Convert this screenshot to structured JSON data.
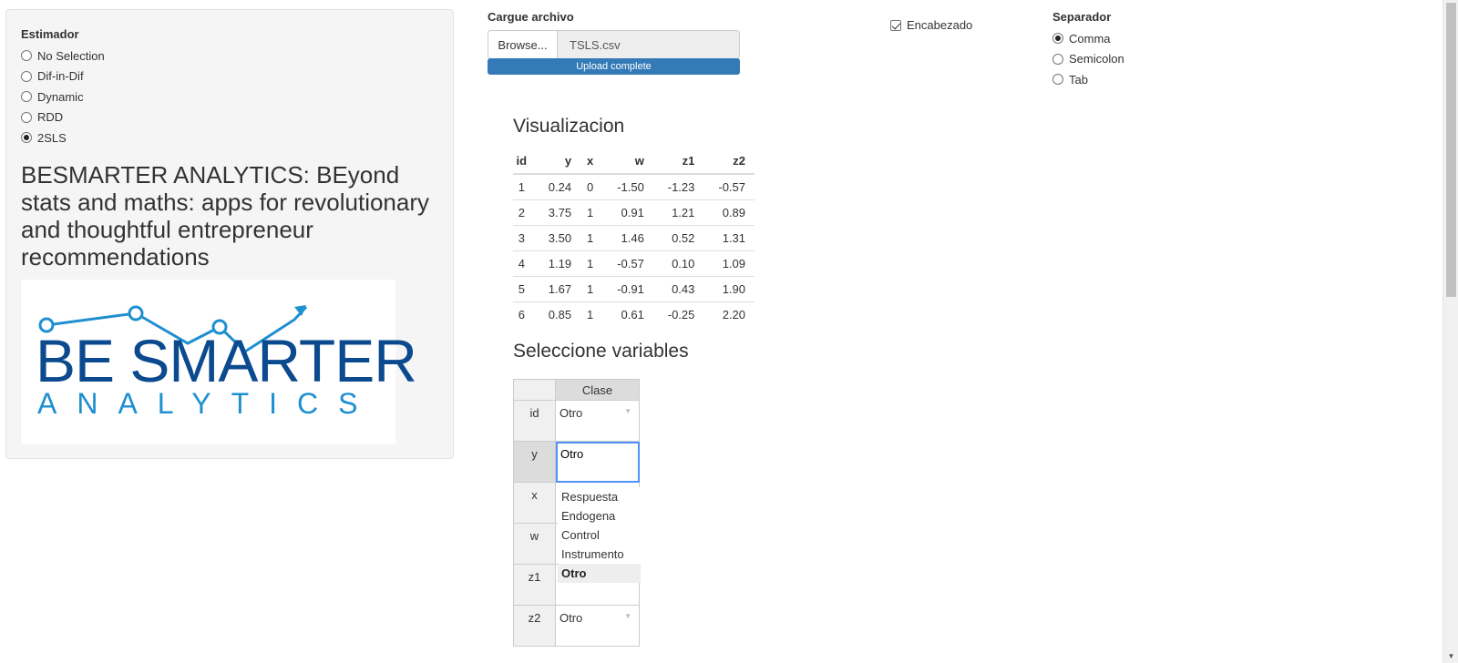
{
  "sidebar": {
    "estimator_label": "Estimador",
    "options": [
      {
        "label": "No Selection",
        "checked": false
      },
      {
        "label": "Dif-in-Dif",
        "checked": false
      },
      {
        "label": "Dynamic",
        "checked": false
      },
      {
        "label": "RDD",
        "checked": false
      },
      {
        "label": "2SLS",
        "checked": true
      }
    ],
    "brand_title": "BESMARTER ANALYTICS: BEyond stats and maths: apps for revolutionary and thoughtful entrepreneur recommendations",
    "logo": {
      "line1": "BE SMARTER",
      "line2": "ANALYTICS",
      "primary_color": "#0b4a8f",
      "accent_color": "#1e8fd0"
    }
  },
  "upload": {
    "label": "Cargue archivo",
    "browse_label": "Browse...",
    "file_name": "TSLS.csv",
    "progress_text": "Upload complete",
    "progress_fraction": 1.0,
    "progress_color": "#337ab7"
  },
  "header_option": {
    "label": "Encabezado",
    "checked": true
  },
  "separator": {
    "label": "Separador",
    "options": [
      {
        "label": "Comma",
        "checked": true
      },
      {
        "label": "Semicolon",
        "checked": false
      },
      {
        "label": "Tab",
        "checked": false
      }
    ]
  },
  "visualization": {
    "title": "Visualizacion",
    "columns": [
      "id",
      "y",
      "x",
      "w",
      "z1",
      "z2"
    ],
    "rows": [
      [
        "1",
        "0.24",
        "0",
        "-1.50",
        "-1.23",
        "-0.57"
      ],
      [
        "2",
        "3.75",
        "1",
        "0.91",
        "1.21",
        "0.89"
      ],
      [
        "3",
        "3.50",
        "1",
        "1.46",
        "0.52",
        "1.31"
      ],
      [
        "4",
        "1.19",
        "1",
        "-0.57",
        "0.10",
        "1.09"
      ],
      [
        "5",
        "1.67",
        "1",
        "-0.91",
        "0.43",
        "1.90"
      ],
      [
        "6",
        "0.85",
        "1",
        "0.61",
        "-0.25",
        "2.20"
      ]
    ]
  },
  "variables": {
    "title": "Seleccione variables",
    "column_header": "Clase",
    "rows": [
      {
        "name": "id",
        "value": "Otro"
      },
      {
        "name": "y",
        "value": "Otro"
      },
      {
        "name": "x",
        "value": ""
      },
      {
        "name": "w",
        "value": ""
      },
      {
        "name": "z1",
        "value": ""
      },
      {
        "name": "z2",
        "value": "Otro"
      }
    ],
    "dropdown_options": [
      "Respuesta",
      "Endogena",
      "Control",
      "Instrumento",
      "Otro"
    ],
    "dropdown_selected": "Otro"
  }
}
